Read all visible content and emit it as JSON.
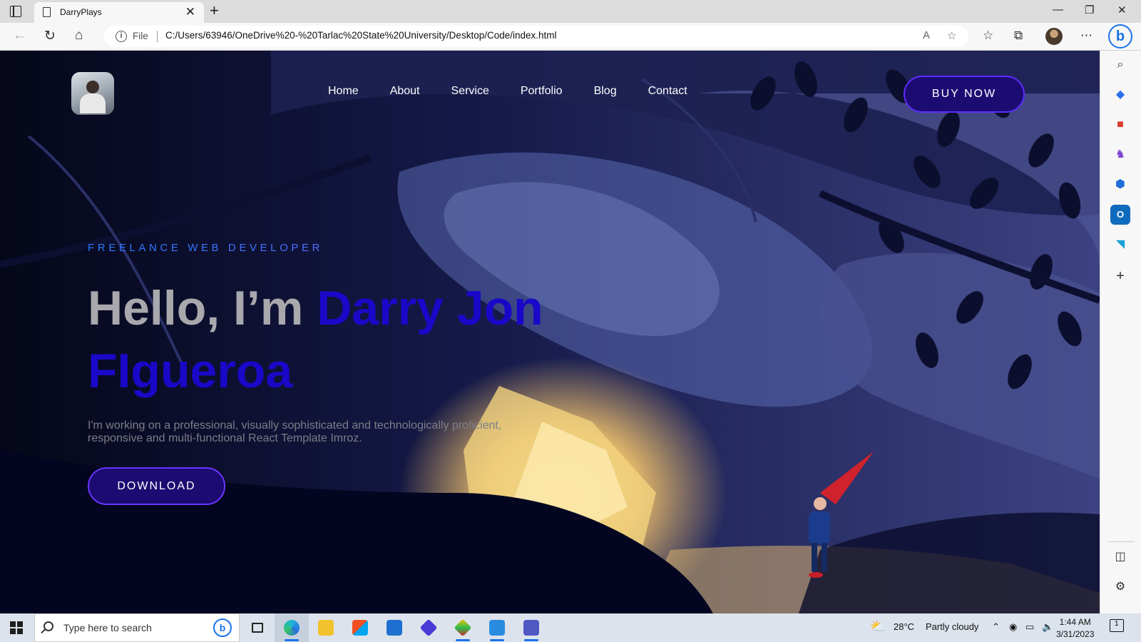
{
  "browser": {
    "tab_title": "DarryPlays",
    "address_scheme": "File",
    "url": "C:/Users/63946/OneDrive%20-%20Tarlac%20State%20University/Desktop/Code/index.html"
  },
  "site": {
    "nav": [
      "Home",
      "About",
      "Service",
      "Portfolio",
      "Blog",
      "Contact"
    ],
    "buy_label": "BUY NOW",
    "kicker": "FREELANCE WEB DEVELOPER",
    "headline_plain": "Hello, I’m ",
    "headline_name": "Darry Jon FIgueroa",
    "description": "I'm working on a professional, visually sophisticated and technologically proficient, responsive and multi-functional React Template Imroz.",
    "download_label": "DOWNLOAD"
  },
  "taskbar": {
    "search_placeholder": "Type here to search",
    "weather_temp": "28°C",
    "weather_text": "Partly cloudy",
    "time": "1:44 AM",
    "date": "3/31/2023",
    "notification_count": "1"
  },
  "colors": {
    "accent_button": "#1c0c72",
    "name_blue": "#1a08c8",
    "night_sky": "#080a24"
  }
}
